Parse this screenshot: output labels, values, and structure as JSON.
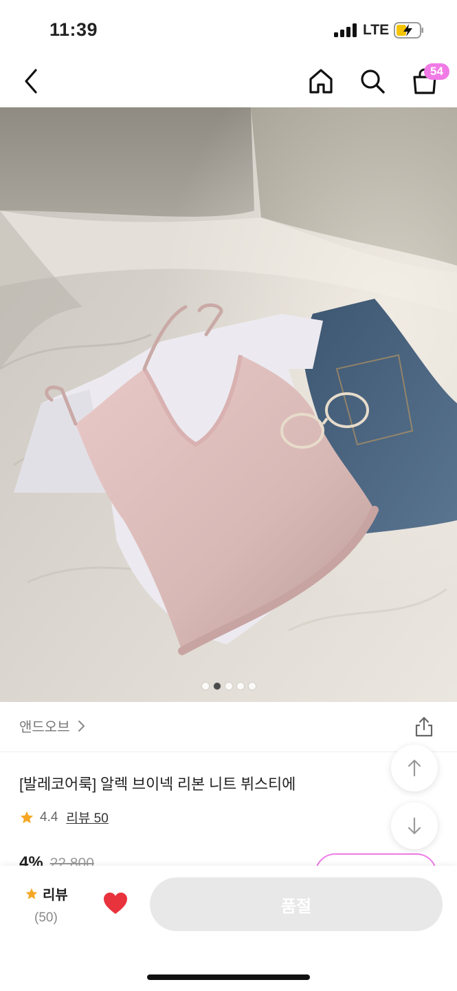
{
  "status_bar": {
    "time": "11:39",
    "network": "LTE"
  },
  "nav": {
    "cart_count": "54"
  },
  "carousel": {
    "total": 5,
    "active_index": 1
  },
  "product": {
    "brand": "앤드오브",
    "title": "[발레코어룩] 알렉 브이넥 리본 니트 뷔스티에",
    "rating": "4.4",
    "review_link": "리뷰 50",
    "discount": "4%",
    "original_price": "22,800"
  },
  "bottom_bar": {
    "review_label": "리뷰",
    "review_count": "(50)",
    "soldout_label": "품절"
  },
  "colors": {
    "accent": "#f07be6",
    "star": "#f5a623",
    "heart": "#e8333d",
    "disabled": "#e8e8e8"
  }
}
